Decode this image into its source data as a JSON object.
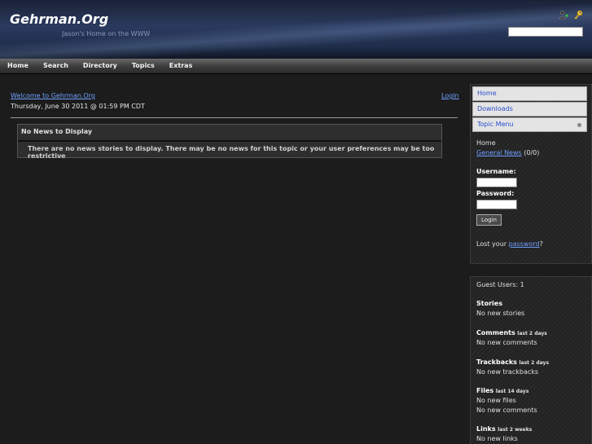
{
  "header": {
    "site_title": "Gehrman.Org",
    "slogan": "Jason's Home on the WWW",
    "icons": [
      "add-user-icon",
      "key-icon"
    ],
    "search_value": ""
  },
  "nav": {
    "items": [
      "Home",
      "Search",
      "Directory",
      "Topics",
      "Extras"
    ]
  },
  "main": {
    "welcome_link": "Welcome to Gehrman.Org",
    "date": "Thursday, June 30 2011 @ 01:59 PM CDT",
    "login_link": "Login",
    "news": {
      "title": "No News to Display",
      "message": "There are no news stories to display. There may be no news for this topic or your user preferences may be too restrictive"
    }
  },
  "sidebar": {
    "menu": [
      "Home",
      "Downloads",
      "Topic Menu"
    ],
    "topic_home": "Home",
    "topic_general_news": "General News",
    "topic_general_count": "(0/0)",
    "username_label": "Username:",
    "password_label": "Password:",
    "login_button": "Login",
    "lost_prefix": "Lost your ",
    "lost_link": "password",
    "lost_suffix": "?",
    "guest_users": "Guest Users: 1",
    "stories_title": "Stories",
    "stories_value": "No new stories",
    "comments_title": "Comments",
    "comments_qual": "last 2 days",
    "comments_value": "No new comments",
    "trackbacks_title": "Trackbacks",
    "trackbacks_qual": "last 2 days",
    "trackbacks_value": "No new trackbacks",
    "files_title": "Files",
    "files_qual": "last 14 days",
    "files_value1": "No new files",
    "files_value2": "No new comments",
    "links_title": "Links",
    "links_qual": "last 2 weeks",
    "links_value": "No new links"
  },
  "colors": {
    "link": "#6fa0ff",
    "background": "#1c1c1c",
    "header": "#2a3a5e"
  }
}
